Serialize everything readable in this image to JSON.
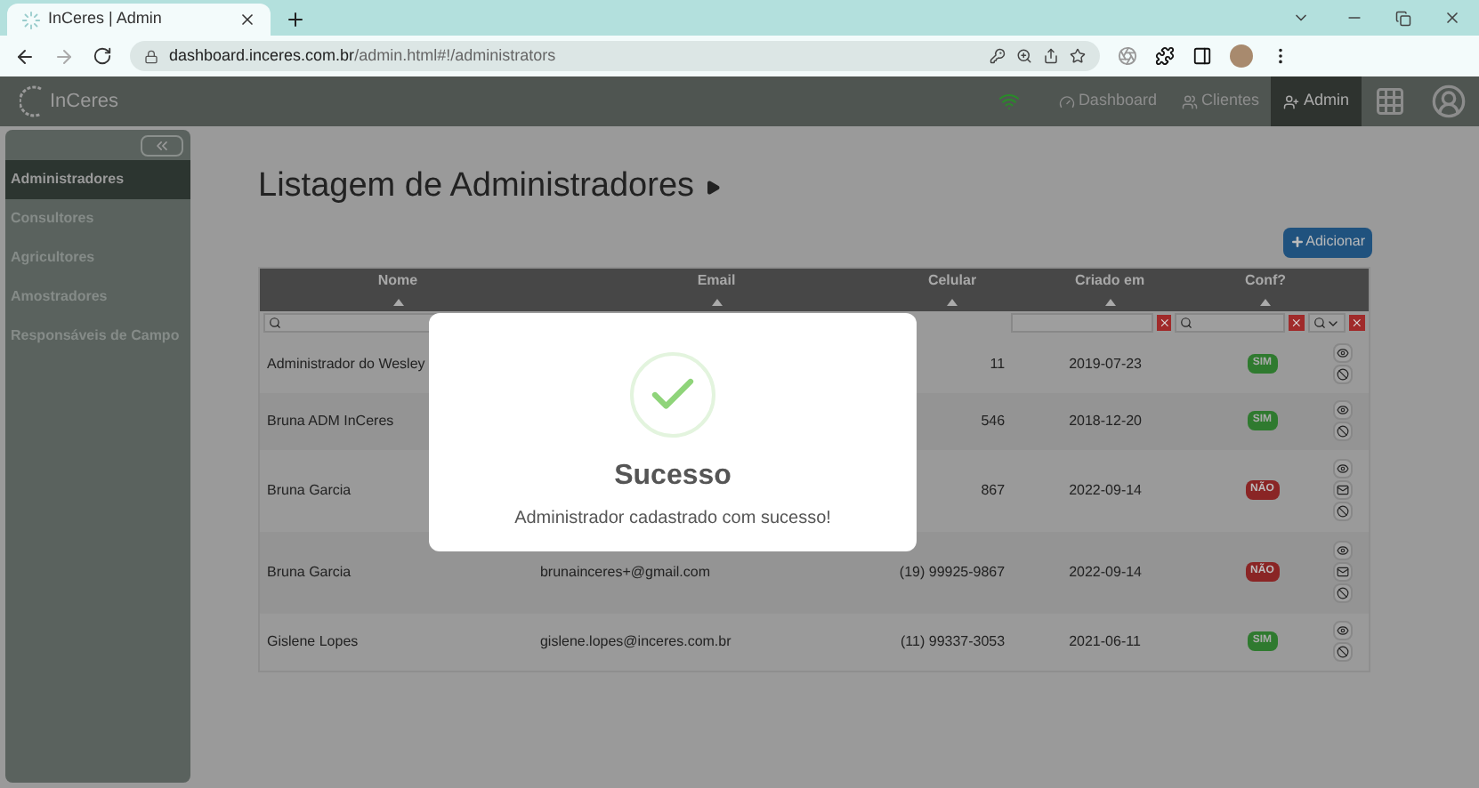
{
  "browser": {
    "tab_title": "InCeres | Admin",
    "url_host": "dashboard.inceres.com.br",
    "url_path": "/admin.html#!/administrators"
  },
  "navbar": {
    "logo": "InCeres",
    "items": [
      {
        "label": "Dashboard",
        "selected": false
      },
      {
        "label": "Clientes",
        "selected": false
      },
      {
        "label": "Admin",
        "selected": true
      }
    ]
  },
  "sidebar": {
    "items": [
      {
        "label": "Administradores",
        "selected": true
      },
      {
        "label": "Consultores",
        "selected": false
      },
      {
        "label": "Agricultores",
        "selected": false
      },
      {
        "label": "Amostradores",
        "selected": false
      },
      {
        "label": "Responsáveis de Campo",
        "selected": false
      }
    ]
  },
  "page": {
    "title": "Listagem de Administradores",
    "add_button": "Adicionar"
  },
  "table": {
    "columns": [
      "Nome",
      "Email",
      "Celular",
      "Criado em",
      "Conf?"
    ],
    "rows": [
      {
        "name": "Administrador do Wesley",
        "phone": "11",
        "created": "2019-07-23",
        "confirmed": true,
        "badge": "SIM",
        "actions": [
          {
            "kind": "view"
          },
          {
            "kind": "block"
          }
        ]
      },
      {
        "name": "Bruna ADM InCeres",
        "phone": "546",
        "created": "2018-12-20",
        "confirmed": true,
        "badge": "SIM",
        "actions": [
          {
            "kind": "view"
          },
          {
            "kind": "block"
          }
        ]
      },
      {
        "name": "Bruna Garcia",
        "phone": "867",
        "created": "2022-09-14",
        "confirmed": false,
        "badge": "NÃO",
        "actions": [
          {
            "kind": "view"
          },
          {
            "kind": "mail"
          },
          {
            "kind": "block"
          }
        ]
      },
      {
        "name": "Bruna Garcia",
        "email": "brunainceres+@gmail.com",
        "phone": "(19) 99925-9867",
        "created": "2022-09-14",
        "confirmed": false,
        "badge": "NÃO",
        "actions": [
          {
            "kind": "view"
          },
          {
            "kind": "mail"
          },
          {
            "kind": "block"
          }
        ]
      },
      {
        "name": "Gislene Lopes",
        "email": "gislene.lopes@inceres.com.br",
        "phone": "(11) 99337-3053",
        "created": "2021-06-11",
        "confirmed": true,
        "badge": "SIM",
        "actions": [
          {
            "kind": "view"
          },
          {
            "kind": "block"
          }
        ]
      }
    ]
  },
  "modal": {
    "title": "Sucesso",
    "message": "Administrador cadastrado com sucesso!"
  }
}
